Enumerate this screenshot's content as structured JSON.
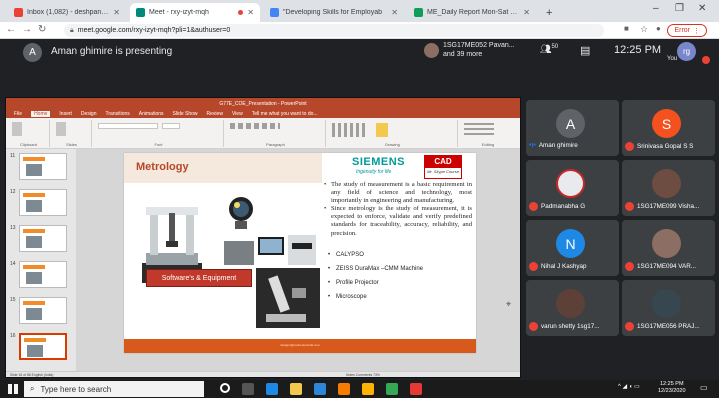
{
  "browser": {
    "tabs": [
      {
        "label": "Inbox (1,082) - deshpande@sayi",
        "favicon_color": "#ea4335",
        "active": false
      },
      {
        "label": "Meet - rxy-izyt-mqh",
        "favicon_color": "#00897b",
        "active": true
      },
      {
        "label": "\"Developing Skills for Employab",
        "favicon_color": "#4285f4",
        "active": false
      },
      {
        "label": "ME_Daily Report Mon-Sat - Goo",
        "favicon_color": "#0f9d58",
        "active": false
      }
    ],
    "new_tab": "+",
    "url": "meet.google.com/rxy-izyt-mqh?pli=1&authuser=0",
    "error_label": "Error"
  },
  "meet": {
    "presenter_initial": "A",
    "presenting_text": "Aman ghimire is presenting",
    "participants_summary_line1": "1SG17ME052 Pavan...",
    "participants_summary_line2": "and 39 more",
    "people_count": "50",
    "clock": "12:25 PM",
    "you_initial": "rg",
    "you_label": "You"
  },
  "powerpoint": {
    "title": "G77E_COE_Presentation - PowerPoint",
    "ribbon_tabs": [
      "File",
      "Home",
      "Insert",
      "Design",
      "Transitions",
      "Animations",
      "Slide Show",
      "Review",
      "View",
      "Tell me what you want to do..."
    ],
    "ribbon_groups": [
      "Clipboard",
      "Slides",
      "Font",
      "Paragraph",
      "Drawing",
      "Editing"
    ],
    "thumb_numbers": [
      "11",
      "12",
      "13",
      "14",
      "15",
      "16"
    ],
    "status_left": "Slide 16 of 86  English (India)",
    "status_right": "Notes  Comments  73%",
    "slide": {
      "title": "Metrology",
      "brand": "SIEMENS",
      "brand_tagline": "Ingenuity for life",
      "cad_logo_text": "CAD",
      "cad_logo_sub": "Mr. Skype Course",
      "button_label": "Software's & Equipment",
      "bullet_paragraphs": [
        "The study of measurement is a basic requirement in any field of science and technology, most importantly in engineering and manufacturing.",
        "Since metrology is the study of measurement, it is expected to enforce, validate and verify predefined standards for traceability, accuracy, reliability, and precision."
      ],
      "equipment_list": [
        "CALYPSO",
        "ZEISS DuraMax –CMM Machine",
        "Profile Projector",
        "Microscope"
      ],
      "footer_text": "designs@cadcentreindia.com"
    }
  },
  "tiles": [
    {
      "name": "Aman ghimire",
      "initial": "A",
      "color": "#5f6368",
      "indicator": "speaking"
    },
    {
      "name": "Srinivasa Gopal S S",
      "initial": "S",
      "color": "#f4511e",
      "indicator": "muted"
    },
    {
      "name": "Padmanabha G",
      "initial": "",
      "color": "#e8eaed",
      "indicator": "muted"
    },
    {
      "name": "1SG17ME099 Visha...",
      "initial": "",
      "color": "#6d4c41",
      "indicator": "muted"
    },
    {
      "name": "Nihal J Kashyap",
      "initial": "N",
      "color": "#1e88e5",
      "indicator": "muted"
    },
    {
      "name": "1SG17ME094 VAR...",
      "initial": "",
      "color": "#8d6e63",
      "indicator": "muted"
    },
    {
      "name": "varun shetty 1sg17...",
      "initial": "",
      "color": "#5d4037",
      "indicator": "muted"
    },
    {
      "name": "1SG17ME056 PRAJ...",
      "initial": "",
      "color": "#37474f",
      "indicator": "muted"
    }
  ],
  "taskbar": {
    "search_placeholder": "Type here to search",
    "time": "12:25 PM",
    "date": "12/23/2020"
  }
}
